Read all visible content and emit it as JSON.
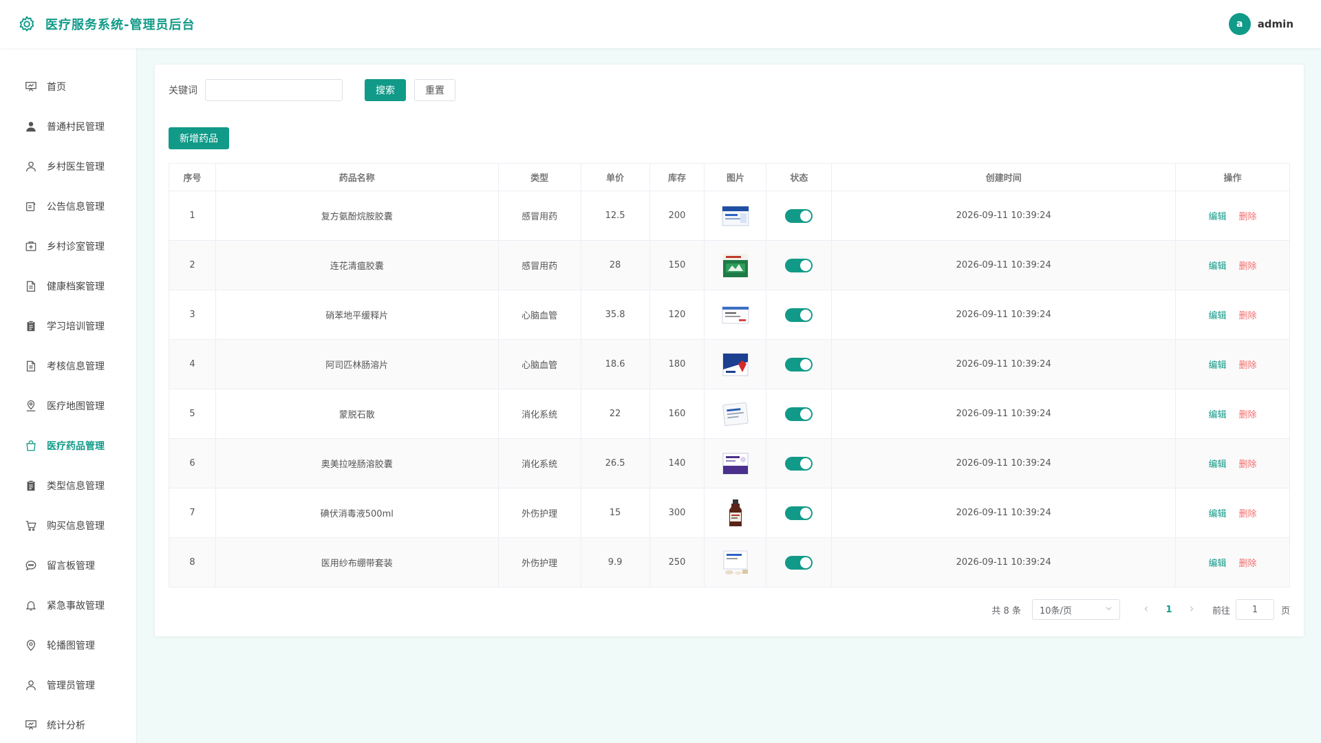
{
  "header": {
    "title": "医疗服务系统-管理员后台",
    "avatar_letter": "a",
    "username": "admin"
  },
  "colors": {
    "primary": "#119a88",
    "danger": "#f56c6c"
  },
  "sidebar": {
    "items": [
      {
        "label": "首页",
        "icon": "presentation-icon"
      },
      {
        "label": "普通村民管理",
        "icon": "user-filled-icon"
      },
      {
        "label": "乡村医生管理",
        "icon": "user-icon"
      },
      {
        "label": "公告信息管理",
        "icon": "notice-icon"
      },
      {
        "label": "乡村诊室管理",
        "icon": "first-aid-kit-icon"
      },
      {
        "label": "健康档案管理",
        "icon": "document-icon"
      },
      {
        "label": "学习培训管理",
        "icon": "clipboard-filled-icon"
      },
      {
        "label": "考核信息管理",
        "icon": "document-icon"
      },
      {
        "label": "医疗地图管理",
        "icon": "map-location-icon"
      },
      {
        "label": "医疗药品管理",
        "icon": "shopping-bag-icon",
        "active": true
      },
      {
        "label": "类型信息管理",
        "icon": "clipboard-filled-icon"
      },
      {
        "label": "购买信息管理",
        "icon": "shopping-cart-icon"
      },
      {
        "label": "留言板管理",
        "icon": "chat-icon"
      },
      {
        "label": "紧急事故管理",
        "icon": "bell-icon"
      },
      {
        "label": "轮播图管理",
        "icon": "location-icon"
      },
      {
        "label": "管理员管理",
        "icon": "user-icon"
      },
      {
        "label": "统计分析",
        "icon": "presentation-icon"
      }
    ]
  },
  "search": {
    "keyword_label": "关键词",
    "keyword_value": "",
    "search_label": "搜索",
    "reset_label": "重置"
  },
  "toolbar": {
    "add_label": "新增药品"
  },
  "table": {
    "headers": [
      "序号",
      "药品名称",
      "类型",
      "单价",
      "库存",
      "图片",
      "状态",
      "创建时间",
      "操作"
    ],
    "rows": [
      {
        "no": "1",
        "name": "复方氨酚烷胺胶囊",
        "type": "感冒用药",
        "price": "12.5",
        "stock": "200",
        "enabled": true,
        "created": "2026-09-11 10:39:24",
        "image": "blue-white-box"
      },
      {
        "no": "2",
        "name": "连花清瘟胶囊",
        "type": "感冒用药",
        "price": "28",
        "stock": "150",
        "enabled": true,
        "created": "2026-09-11 10:39:24",
        "image": "green-box"
      },
      {
        "no": "3",
        "name": "硝苯地平缓释片",
        "type": "心脑血管",
        "price": "35.8",
        "stock": "120",
        "enabled": true,
        "created": "2026-09-11 10:39:24",
        "image": "white-box"
      },
      {
        "no": "4",
        "name": "阿司匹林肠溶片",
        "type": "心脑血管",
        "price": "18.6",
        "stock": "180",
        "enabled": true,
        "created": "2026-09-11 10:39:24",
        "image": "red-blue-box"
      },
      {
        "no": "5",
        "name": "蒙脱石散",
        "type": "消化系统",
        "price": "22",
        "stock": "160",
        "enabled": true,
        "created": "2026-09-11 10:39:24",
        "image": "sachet"
      },
      {
        "no": "6",
        "name": "奥美拉唑肠溶胶囊",
        "type": "消化系统",
        "price": "26.5",
        "stock": "140",
        "enabled": true,
        "created": "2026-09-11 10:39:24",
        "image": "purple-box"
      },
      {
        "no": "7",
        "name": "碘伏消毒液500ml",
        "type": "外伤护理",
        "price": "15",
        "stock": "300",
        "enabled": true,
        "created": "2026-09-11 10:39:24",
        "image": "brown-bottle"
      },
      {
        "no": "8",
        "name": "医用纱布绷带套装",
        "type": "外伤护理",
        "price": "9.9",
        "stock": "250",
        "enabled": true,
        "created": "2026-09-11 10:39:24",
        "image": "bandage-kit"
      }
    ],
    "edit_label": "编辑",
    "delete_label": "删除"
  },
  "pagination": {
    "total_text": "共 8 条",
    "page_size": "10条/页",
    "current_page": "1",
    "goto_label": "前往",
    "goto_value": "1",
    "page_unit": "页"
  }
}
